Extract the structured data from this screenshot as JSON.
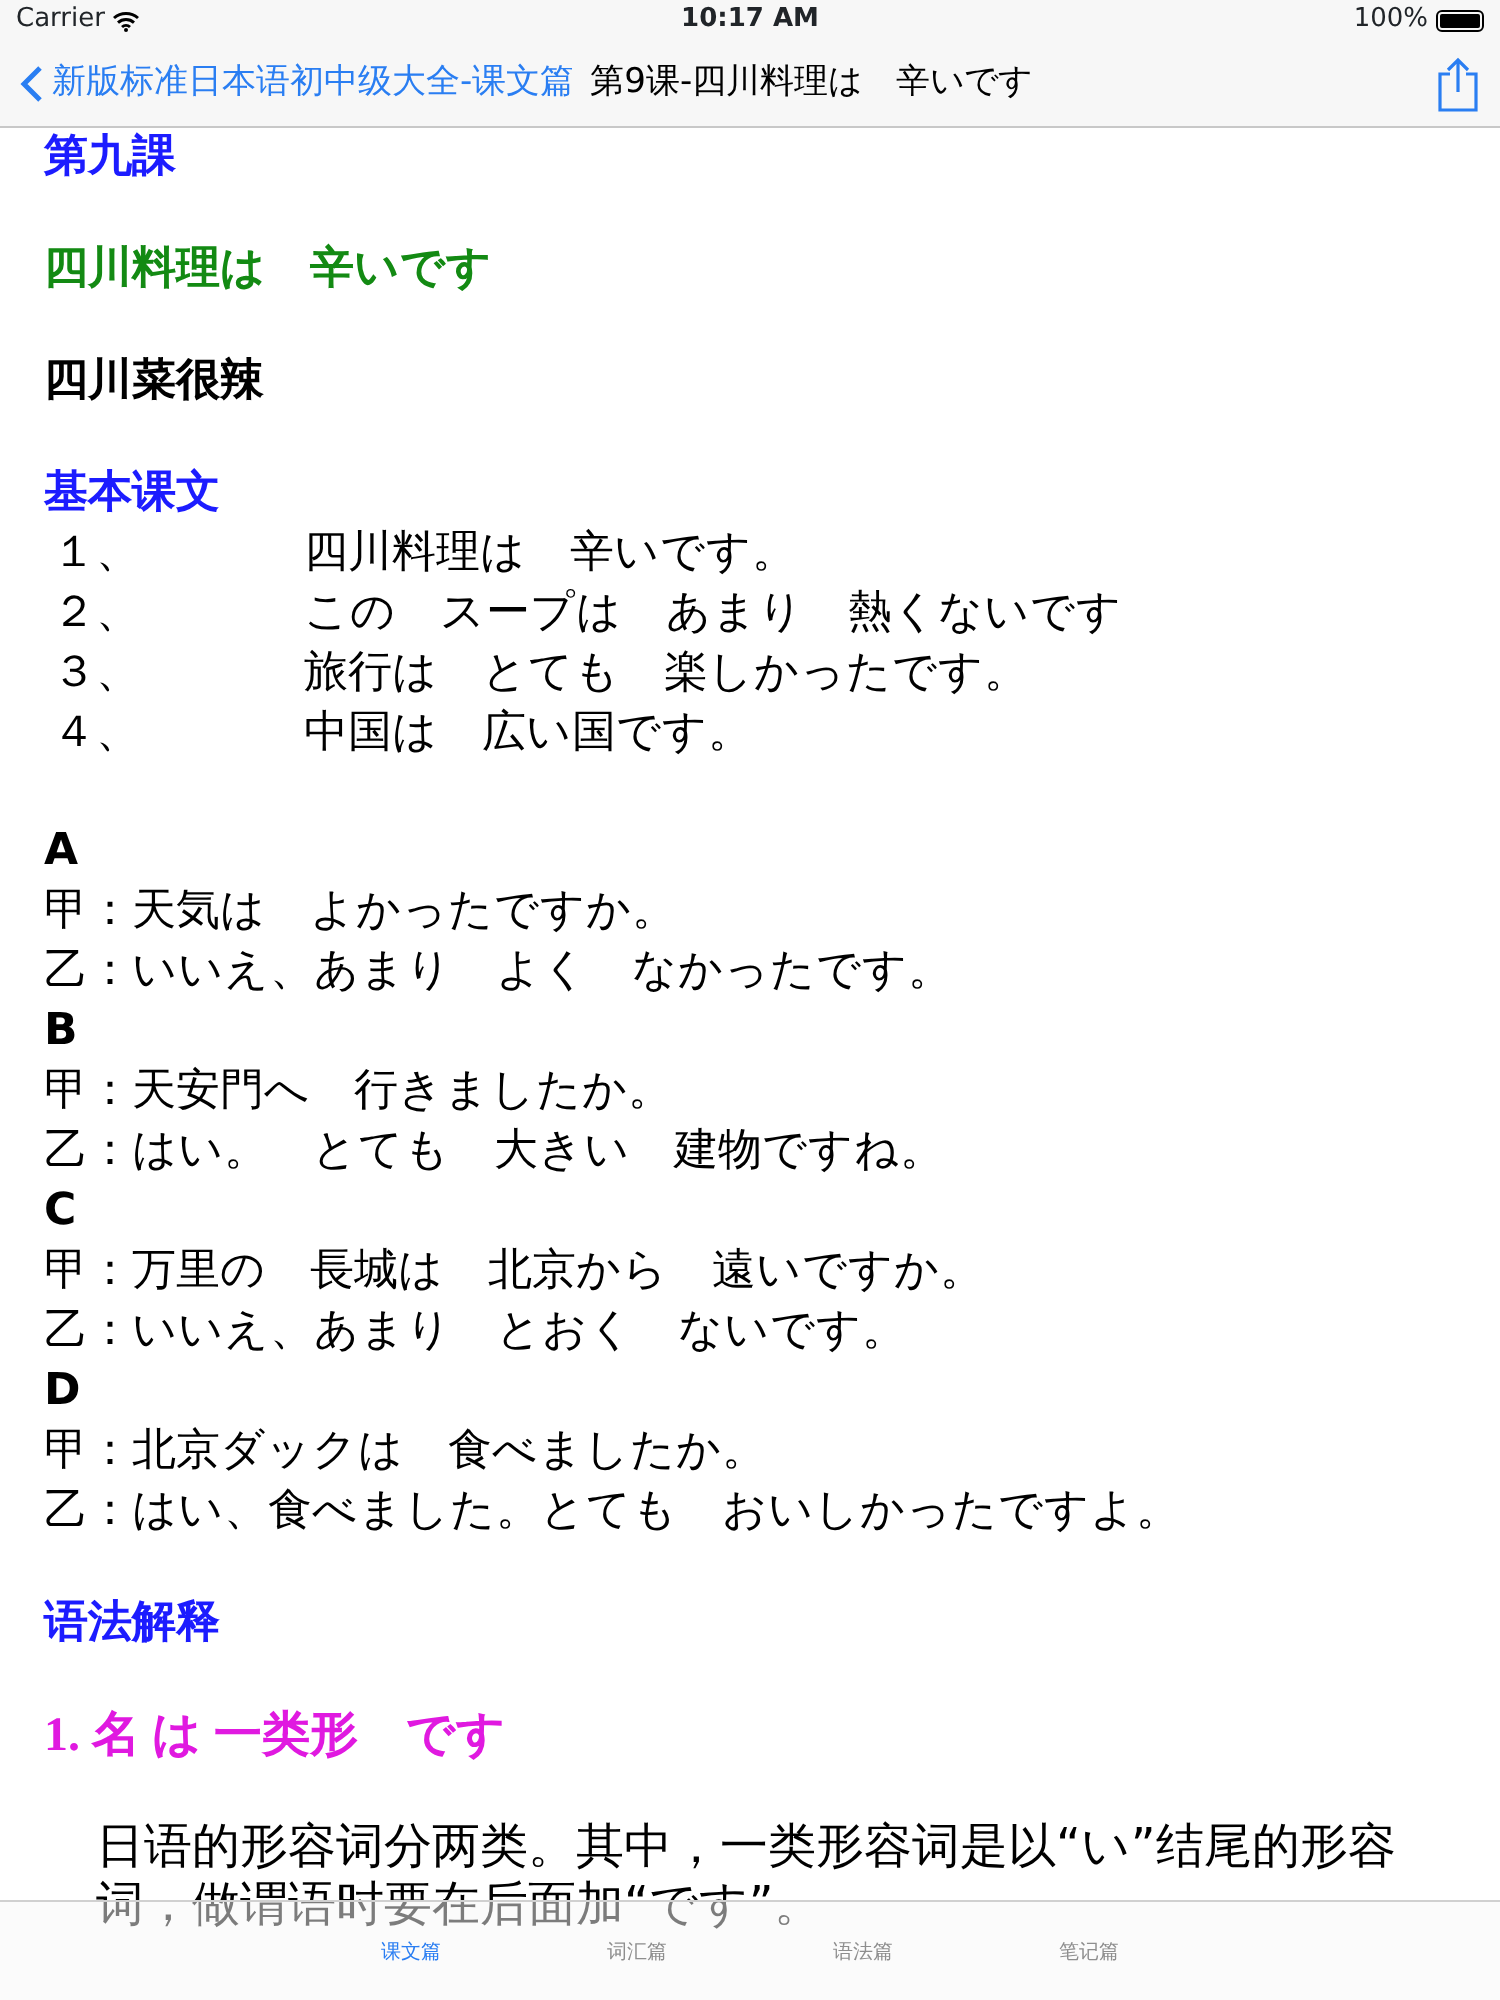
{
  "status_bar": {
    "carrier": "Carrier",
    "time": "10:17 AM",
    "battery": "100%"
  },
  "nav": {
    "back_label": "新版标准日本语初中级大全-课文篇",
    "title": "第9课-四川料理は　辛いです"
  },
  "lesson_title": "第九課",
  "title_ja": "四川料理は　辛いです",
  "title_zh": "四川菜很辣",
  "basic_text": {
    "heading": "基本课文",
    "sentences": [
      {
        "number": "１、",
        "text": "四川料理は　辛いです。"
      },
      {
        "number": "２、",
        "text": "この　スープは　あまり　熱くないです"
      },
      {
        "number": "３、",
        "text": "旅行は　とても　楽しかったです。"
      },
      {
        "number": "４、",
        "text": "中国は　広い国です。"
      }
    ]
  },
  "dialogs": [
    {
      "label": "A",
      "lines": [
        {
          "speaker": "甲：",
          "text": "天気は　よかったですか。"
        },
        {
          "speaker": "乙：",
          "text": "いいえ、あまり　よく　なかったです。"
        }
      ]
    },
    {
      "label": "B",
      "lines": [
        {
          "speaker": "甲：",
          "text": "天安門へ　行きましたか。"
        },
        {
          "speaker": "乙：",
          "text": "はい。　とても　大きい　建物ですね。"
        }
      ]
    },
    {
      "label": "C",
      "lines": [
        {
          "speaker": "甲：",
          "text": "万里の　長城は　北京から　遠いですか。"
        },
        {
          "speaker": "乙：",
          "text": "いいえ、あまり　とおく　ないです。"
        }
      ]
    },
    {
      "label": "D",
      "lines": [
        {
          "speaker": "甲：",
          "text": "北京ダックは　食べましたか。"
        },
        {
          "speaker": "乙：",
          "text": "はい、食べました。とても　おいしかったですよ。"
        }
      ]
    }
  ],
  "grammar": {
    "heading": "语法解释",
    "points": [
      {
        "title": "1.  名 は 一类形　です",
        "paragraph": "日语的形容词分两类。其中，一类形容词是以“い”结尾的形容词，做谓语时要在后面加“です”。"
      }
    ]
  },
  "tab_bar": [
    {
      "label": "课文篇",
      "selected": true
    },
    {
      "label": "词汇篇",
      "selected": false
    },
    {
      "label": "语法篇",
      "selected": false
    },
    {
      "label": "笔记篇",
      "selected": false
    }
  ]
}
